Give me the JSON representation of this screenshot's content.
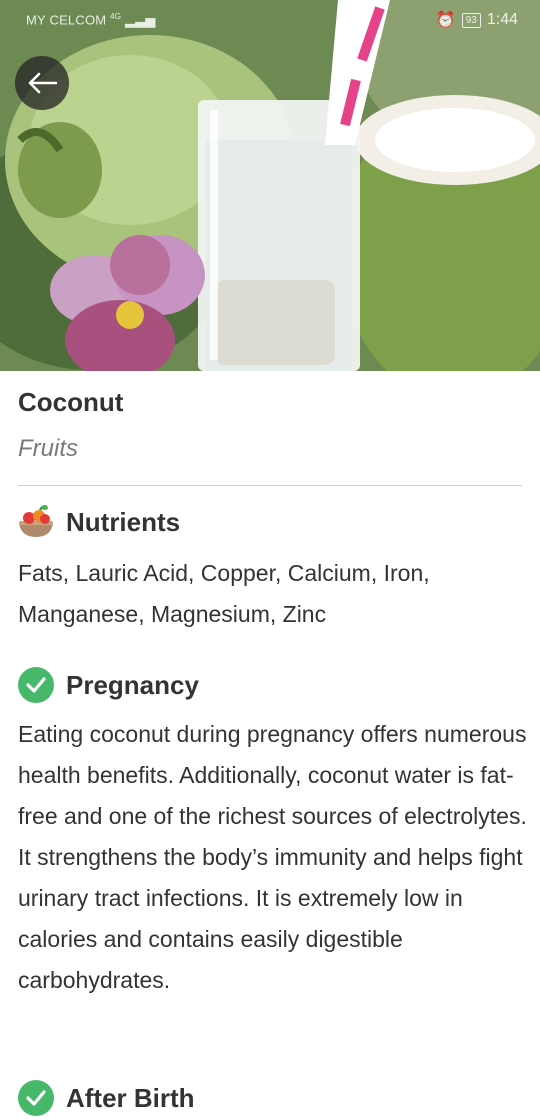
{
  "status_bar": {
    "carrier": "MY CELCOM",
    "network": "4G",
    "battery": "93",
    "time": "1:44"
  },
  "food": {
    "name": "Coconut",
    "category": "Fruits"
  },
  "sections": {
    "nutrients": {
      "heading": "Nutrients",
      "icon": "fruit-basket-icon",
      "text": "Fats, Lauric Acid, Copper, Calcium, Iron, Manganese, Magnesium, Zinc"
    },
    "pregnancy": {
      "heading": "Pregnancy",
      "icon": "check-circle-icon",
      "text": "Eating coconut during pregnancy offers numerous health benefits. Additionally, coconut water is fat-free and one of the richest sources of electrolytes. It strengthens the body’s immunity and helps fight urinary tract infections. It is extremely low in calories and contains easily digestible carbohydrates."
    },
    "after_birth": {
      "heading": "After Birth",
      "icon": "check-circle-icon"
    }
  },
  "colors": {
    "check_green": "#47b86a",
    "text": "#333333",
    "muted": "#7a7a7a"
  }
}
